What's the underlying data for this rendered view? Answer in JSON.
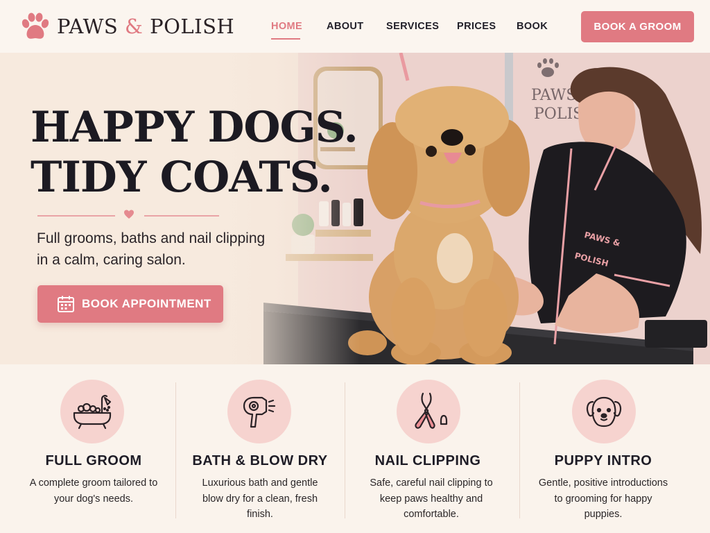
{
  "brand": {
    "name_part1": "PAWS",
    "ampersand": "&",
    "name_part2": "POLISH",
    "accent_color": "#e07a82",
    "logo_icon": "paw-icon"
  },
  "nav": {
    "items": [
      {
        "label": "HOME",
        "active": true
      },
      {
        "label": "ABOUT",
        "active": false
      },
      {
        "label": "SERVICES",
        "active": false
      },
      {
        "label": "PRICES",
        "active": false
      },
      {
        "label": "BOOK",
        "active": false
      }
    ],
    "cta_label": "BOOK A GROOM"
  },
  "hero": {
    "title_line1": "HAPPY DOGS.",
    "title_line2": "TIDY COATS.",
    "subtitle": "Full grooms, baths and nail clipping in a calm, caring salon.",
    "button_label": "BOOK APPOINTMENT",
    "button_icon": "calendar-icon",
    "wall_sign_line1": "PAWS &",
    "wall_sign_line2": "POLISH",
    "uniform_line1": "PAWS &",
    "uniform_line2": "POLISH"
  },
  "services": [
    {
      "icon": "bathtub-icon",
      "title": "FULL GROOM",
      "description": "A complete groom tailored to your dog's needs."
    },
    {
      "icon": "hair-dryer-icon",
      "title": "BATH & BLOW DRY",
      "description": "Luxurious bath and gentle blow dry for a clean, fresh finish."
    },
    {
      "icon": "nail-clipper-icon",
      "title": "NAIL CLIPPING",
      "description": "Safe, careful nail clipping to keep paws healthy and comfortable."
    },
    {
      "icon": "puppy-icon",
      "title": "PUPPY INTRO",
      "description": "Gentle, positive introductions to grooming for happy puppies."
    }
  ],
  "colors": {
    "background": "#f8f1ea",
    "accent": "#e07a82",
    "icon_circle": "#f6d3cf",
    "text_dark": "#1e1a1d"
  }
}
